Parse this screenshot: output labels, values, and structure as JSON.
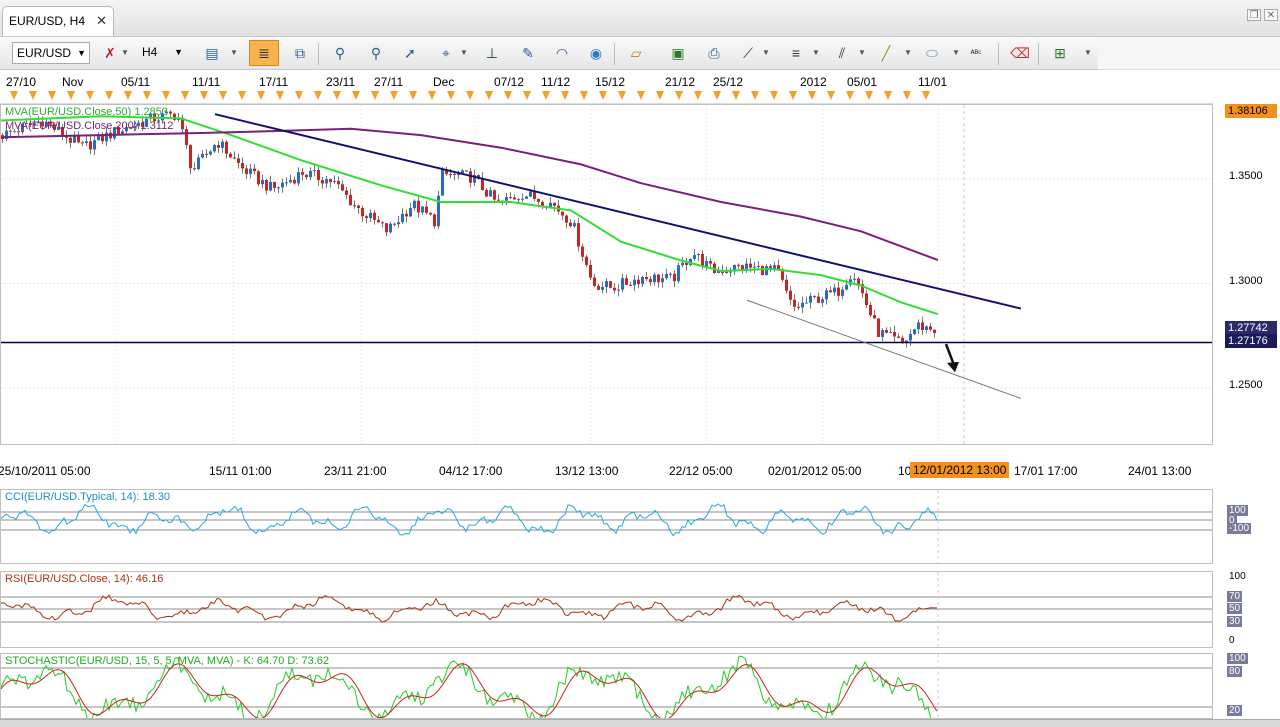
{
  "tab": {
    "title": "EUR/USD, H4"
  },
  "toolbar": {
    "symbol": "EUR/USD",
    "timeframe": "H4"
  },
  "date_strip": [
    "27/10",
    "Nov",
    "05/11",
    "11/11",
    "17/11",
    "23/11",
    "27/11",
    "Dec",
    "07/12",
    "11/12",
    "15/12",
    "21/12",
    "25/12",
    "2012",
    "05/01",
    "11/01"
  ],
  "main_chart": {
    "indicators": [
      "MVA(EUR/USD.Close,50) 1.2853",
      "MVA(EUR/USD.Close,200) 1.3112"
    ],
    "price_axis": [
      "1.3500",
      "1.3000",
      "1.2500"
    ],
    "badges": {
      "top": "1.38106",
      "current": "1.27742",
      "line": "1.27176"
    }
  },
  "time_axis": {
    "labels": [
      "25/10/2011 05:00",
      "15/11 01:00",
      "23/11 21:00",
      "04/12 17:00",
      "13/12 13:00",
      "22/12 05:00",
      "02/01/2012 05:00",
      "10",
      "17/01 17:00",
      "24/01 13:00"
    ],
    "cursor": "12/01/2012 13:00"
  },
  "cci": {
    "label": "CCI(EUR/USD.Typical, 14): 18.30",
    "axis": [
      "100",
      "0",
      "-100"
    ]
  },
  "rsi": {
    "label": "RSI(EUR/USD.Close, 14): 46.16",
    "axis": [
      "100",
      "70",
      "50",
      "30",
      "0"
    ]
  },
  "stochastic": {
    "label": "STOCHASTIC(EUR/USD, 15, 5, 5, MVA, MVA) -  K: 64.70  D: 73.62",
    "axis": [
      "100",
      "80",
      "20"
    ]
  },
  "colors": {
    "ma50": "#33dd33",
    "ma200": "#7a1f7a",
    "trend": "#101070",
    "hline": "#000050",
    "cci": "#22aadd",
    "rsi": "#aa3311",
    "stoch_k": "#22cc22",
    "stoch_d": "#cc2222",
    "badge": "#f3911e"
  },
  "icons": [
    "dropdown-icon",
    "chart-type-icon",
    "zoom-icon",
    "crosshair-icon",
    "cursor-icon",
    "pan-icon",
    "line-tool-icon",
    "fibonacci-icon",
    "text-icon",
    "eraser-icon",
    "layers-icon"
  ]
}
